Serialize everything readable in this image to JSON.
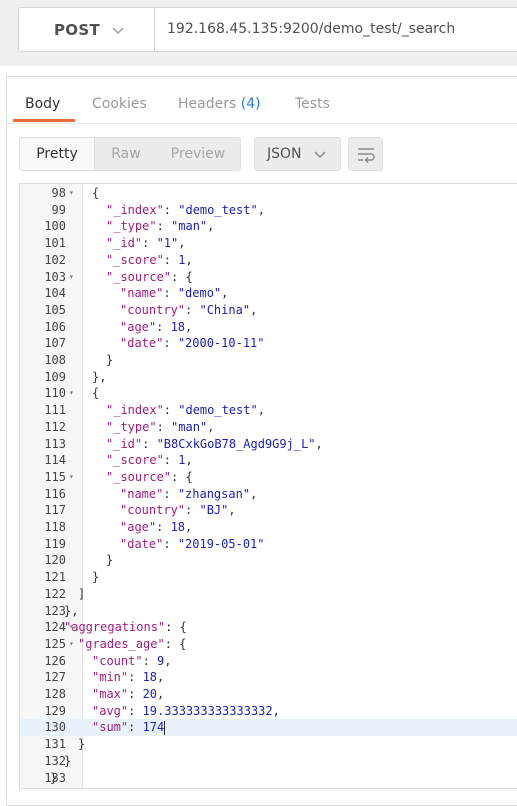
{
  "request": {
    "method": "POST",
    "url": "192.168.45.135:9200/demo_test/_search"
  },
  "tabs": [
    {
      "label": "Body"
    },
    {
      "label": "Cookies"
    },
    {
      "label": "Headers",
      "count": "(4)"
    },
    {
      "label": "Tests"
    }
  ],
  "view_modes": [
    "Pretty",
    "Raw",
    "Preview"
  ],
  "format": "JSON",
  "icons": {
    "method_dropdown": "chevron-down-icon",
    "format_dropdown": "chevron-down-icon",
    "wrap": "wrap-lines-icon"
  },
  "colors": {
    "accent": "#f26b3a",
    "key": "#a21d7d",
    "string": "#1c22b5",
    "count": "#2a7be4"
  },
  "lines": [
    {
      "n": "98",
      "fold": true,
      "indent": 6,
      "t": [
        [
          "p",
          "{"
        ]
      ]
    },
    {
      "n": "99",
      "indent": 7,
      "t": [
        [
          "k",
          "\"_index\""
        ],
        [
          "p",
          ": "
        ],
        [
          "s",
          "\"demo_test\""
        ],
        [
          "p",
          ","
        ]
      ]
    },
    {
      "n": "100",
      "indent": 7,
      "t": [
        [
          "k",
          "\"_type\""
        ],
        [
          "p",
          ": "
        ],
        [
          "s",
          "\"man\""
        ],
        [
          "p",
          ","
        ]
      ]
    },
    {
      "n": "101",
      "indent": 7,
      "t": [
        [
          "k",
          "\"_id\""
        ],
        [
          "p",
          ": "
        ],
        [
          "s",
          "\"1\""
        ],
        [
          "p",
          ","
        ]
      ]
    },
    {
      "n": "102",
      "indent": 7,
      "t": [
        [
          "k",
          "\"_score\""
        ],
        [
          "p",
          ": "
        ],
        [
          "n",
          "1"
        ],
        [
          "p",
          ","
        ]
      ]
    },
    {
      "n": "103",
      "fold": true,
      "indent": 7,
      "t": [
        [
          "k",
          "\"_source\""
        ],
        [
          "p",
          ": {"
        ]
      ]
    },
    {
      "n": "104",
      "indent": 8,
      "t": [
        [
          "k",
          "\"name\""
        ],
        [
          "p",
          ": "
        ],
        [
          "s",
          "\"demo\""
        ],
        [
          "p",
          ","
        ]
      ]
    },
    {
      "n": "105",
      "indent": 8,
      "t": [
        [
          "k",
          "\"country\""
        ],
        [
          "p",
          ": "
        ],
        [
          "s",
          "\"China\""
        ],
        [
          "p",
          ","
        ]
      ]
    },
    {
      "n": "106",
      "indent": 8,
      "t": [
        [
          "k",
          "\"age\""
        ],
        [
          "p",
          ": "
        ],
        [
          "n",
          "18"
        ],
        [
          "p",
          ","
        ]
      ]
    },
    {
      "n": "107",
      "indent": 8,
      "t": [
        [
          "k",
          "\"date\""
        ],
        [
          "p",
          ": "
        ],
        [
          "s",
          "\"2000-10-11\""
        ]
      ]
    },
    {
      "n": "108",
      "indent": 7,
      "t": [
        [
          "p",
          "}"
        ]
      ]
    },
    {
      "n": "109",
      "indent": 6,
      "t": [
        [
          "p",
          "},"
        ]
      ]
    },
    {
      "n": "110",
      "fold": true,
      "indent": 6,
      "t": [
        [
          "p",
          "{"
        ]
      ]
    },
    {
      "n": "111",
      "indent": 7,
      "t": [
        [
          "k",
          "\"_index\""
        ],
        [
          "p",
          ": "
        ],
        [
          "s",
          "\"demo_test\""
        ],
        [
          "p",
          ","
        ]
      ]
    },
    {
      "n": "112",
      "indent": 7,
      "t": [
        [
          "k",
          "\"_type\""
        ],
        [
          "p",
          ": "
        ],
        [
          "s",
          "\"man\""
        ],
        [
          "p",
          ","
        ]
      ]
    },
    {
      "n": "113",
      "indent": 7,
      "t": [
        [
          "k",
          "\"_id\""
        ],
        [
          "p",
          ": "
        ],
        [
          "s",
          "\"B8CxkGoB78_Agd9G9j_L\""
        ],
        [
          "p",
          ","
        ]
      ]
    },
    {
      "n": "114",
      "indent": 7,
      "t": [
        [
          "k",
          "\"_score\""
        ],
        [
          "p",
          ": "
        ],
        [
          "n",
          "1"
        ],
        [
          "p",
          ","
        ]
      ]
    },
    {
      "n": "115",
      "fold": true,
      "indent": 7,
      "t": [
        [
          "k",
          "\"_source\""
        ],
        [
          "p",
          ": {"
        ]
      ]
    },
    {
      "n": "116",
      "indent": 8,
      "t": [
        [
          "k",
          "\"name\""
        ],
        [
          "p",
          ": "
        ],
        [
          "s",
          "\"zhangsan\""
        ],
        [
          "p",
          ","
        ]
      ]
    },
    {
      "n": "117",
      "indent": 8,
      "t": [
        [
          "k",
          "\"country\""
        ],
        [
          "p",
          ": "
        ],
        [
          "s",
          "\"BJ\""
        ],
        [
          "p",
          ","
        ]
      ]
    },
    {
      "n": "118",
      "indent": 8,
      "t": [
        [
          "k",
          "\"age\""
        ],
        [
          "p",
          ": "
        ],
        [
          "n",
          "18"
        ],
        [
          "p",
          ","
        ]
      ]
    },
    {
      "n": "119",
      "indent": 8,
      "t": [
        [
          "k",
          "\"date\""
        ],
        [
          "p",
          ": "
        ],
        [
          "s",
          "\"2019-05-01\""
        ]
      ]
    },
    {
      "n": "120",
      "indent": 7,
      "t": [
        [
          "p",
          "}"
        ]
      ]
    },
    {
      "n": "121",
      "indent": 6,
      "t": [
        [
          "p",
          "}"
        ]
      ]
    },
    {
      "n": "122",
      "indent": 5,
      "t": [
        [
          "p",
          "]"
        ]
      ]
    },
    {
      "n": "123",
      "indent": 4,
      "t": [
        [
          "p",
          "},"
        ]
      ]
    },
    {
      "n": "124",
      "fold": true,
      "indent": 4,
      "t": [
        [
          "k",
          "\"aggregations\""
        ],
        [
          "p",
          ": {"
        ]
      ]
    },
    {
      "n": "125",
      "fold": true,
      "indent": 5,
      "t": [
        [
          "k",
          "\"grades_age\""
        ],
        [
          "p",
          ": {"
        ]
      ]
    },
    {
      "n": "126",
      "indent": 6,
      "t": [
        [
          "k",
          "\"count\""
        ],
        [
          "p",
          ": "
        ],
        [
          "n",
          "9"
        ],
        [
          "p",
          ","
        ]
      ]
    },
    {
      "n": "127",
      "indent": 6,
      "t": [
        [
          "k",
          "\"min\""
        ],
        [
          "p",
          ": "
        ],
        [
          "n",
          "18"
        ],
        [
          "p",
          ","
        ]
      ]
    },
    {
      "n": "128",
      "indent": 6,
      "t": [
        [
          "k",
          "\"max\""
        ],
        [
          "p",
          ": "
        ],
        [
          "n",
          "20"
        ],
        [
          "p",
          ","
        ]
      ]
    },
    {
      "n": "129",
      "indent": 6,
      "t": [
        [
          "k",
          "\"avg\""
        ],
        [
          "p",
          ": "
        ],
        [
          "n",
          "19.333333333333332"
        ],
        [
          "p",
          ","
        ]
      ]
    },
    {
      "n": "130",
      "indent": 6,
      "hl": true,
      "cursor": true,
      "t": [
        [
          "k",
          "\"sum\""
        ],
        [
          "p",
          ": "
        ],
        [
          "n",
          "174"
        ]
      ]
    },
    {
      "n": "131",
      "indent": 5,
      "t": [
        [
          "p",
          "}"
        ]
      ]
    },
    {
      "n": "132",
      "indent": 4,
      "t": [
        [
          "p",
          "}"
        ]
      ]
    },
    {
      "n": "133",
      "indent": 3,
      "t": [
        [
          "p",
          "}"
        ]
      ]
    }
  ]
}
